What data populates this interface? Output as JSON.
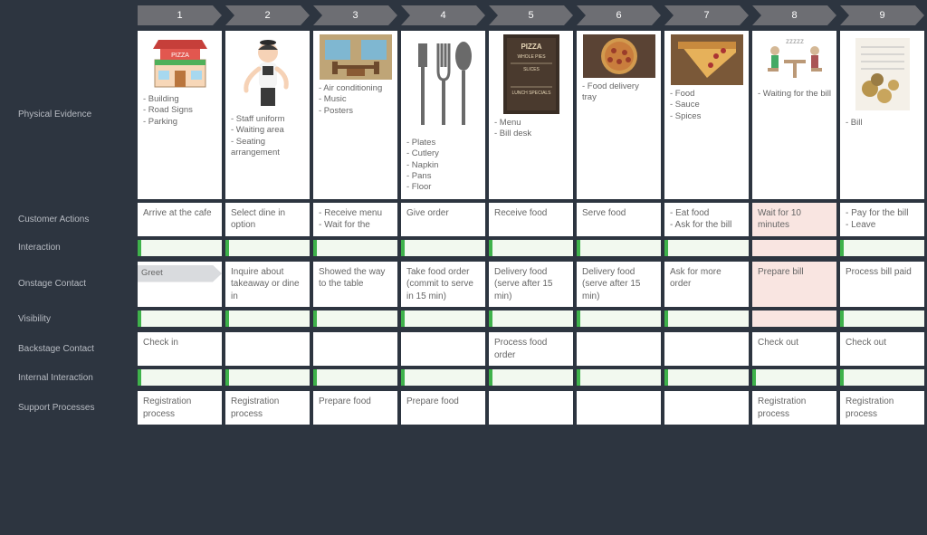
{
  "steps": [
    "1",
    "2",
    "3",
    "4",
    "5",
    "6",
    "7",
    "8",
    "9"
  ],
  "rows": {
    "physical_evidence": {
      "label": "Physical Evidence"
    },
    "customer_actions": {
      "label": "Customer Actions"
    },
    "interaction": {
      "label": "Interaction"
    },
    "onstage": {
      "label": "Onstage Contact"
    },
    "visibility": {
      "label": "Visibility"
    },
    "backstage": {
      "label": "Backstage Contact"
    },
    "internal": {
      "label": "Internal Interaction"
    },
    "support": {
      "label": "Support Processes"
    }
  },
  "evidence": [
    {
      "icon": "pizza-shop-icon",
      "text": "- Building\n- Road Signs\n- Parking"
    },
    {
      "icon": "waitress-icon",
      "text": "- Staff uniform\n- Waiting area\n- Seating arrangement"
    },
    {
      "icon": "interior-icon",
      "text": "- Air conditioning\n- Music\n- Posters"
    },
    {
      "icon": "cutlery-icon",
      "text": "- Plates\n- Cutlery\n- Napkin\n- Pans\n- Floor"
    },
    {
      "icon": "menu-board-icon",
      "text": "- Menu\n- Bill desk"
    },
    {
      "icon": "pizza-round-icon",
      "text": "- Food delivery tray"
    },
    {
      "icon": "pizza-slice-icon",
      "text": "- Food\n- Sauce\n- Spices"
    },
    {
      "icon": "waiting-icon",
      "text": "- Waiting for the bill"
    },
    {
      "icon": "bill-receipt-icon",
      "text": "- Bill"
    }
  ],
  "customer_actions": [
    "Arrive at the cafe",
    "Select dine in option",
    "- Receive menu\n- Wait for the",
    "Give order",
    "Receive food",
    "Serve food",
    "- Eat food\n- Ask for the bill",
    "Wait for 10 minutes",
    "- Pay for the bill\n- Leave"
  ],
  "customer_actions_color": [
    "",
    "",
    "",
    "",
    "",
    "",
    "",
    "pink",
    ""
  ],
  "onstage": [
    "Greet",
    "Inquire about takeaway or dine in",
    "Showed the way to the table",
    "Take food order (commit to serve in 15 min)",
    "Delivery food (serve after 15 min)",
    "Delivery food (serve after 15 min)",
    "Ask for more order",
    "Prepare bill",
    "Process bill paid"
  ],
  "onstage_color": [
    "",
    "",
    "",
    "",
    "",
    "",
    "",
    "pink",
    ""
  ],
  "backstage": [
    "Check in",
    "",
    "",
    "",
    "Process food order",
    "",
    "",
    "Check out",
    "Check out"
  ],
  "support": [
    "Registration process",
    "Registration process",
    "Prepare food",
    "Prepare food",
    "",
    "",
    "",
    "Registration process",
    "Registration process"
  ],
  "interaction_color": [
    "",
    "",
    "",
    "",
    "",
    "",
    "",
    "pink",
    ""
  ],
  "visibility_color": [
    "",
    "",
    "",
    "",
    "",
    "",
    "",
    "pink",
    ""
  ],
  "internal_color": [
    "",
    "",
    "",
    "",
    "",
    "",
    "",
    "",
    ""
  ]
}
